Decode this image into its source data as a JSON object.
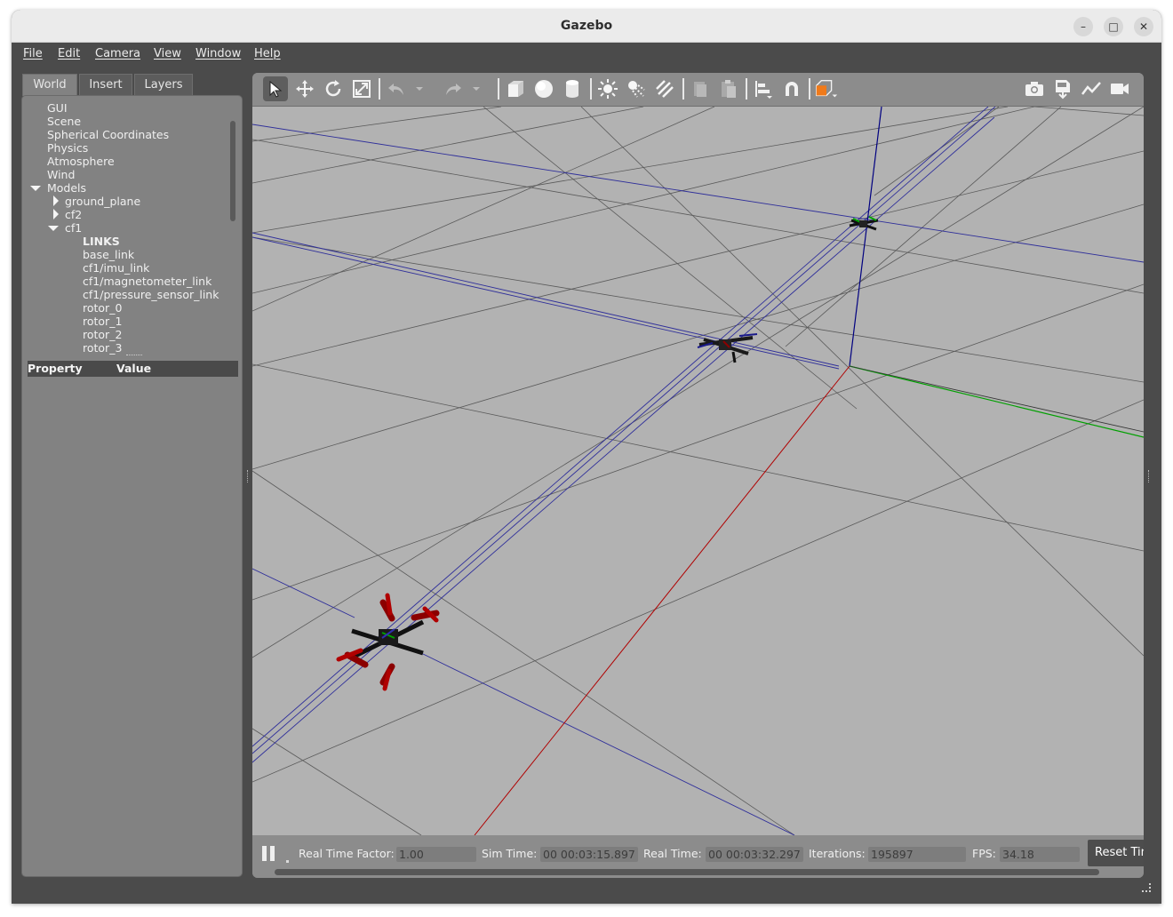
{
  "window": {
    "title": "Gazebo",
    "controls": {
      "minimize": "–",
      "maximize": "□",
      "close": "✕"
    }
  },
  "menubar": {
    "items": [
      "File",
      "Edit",
      "Camera",
      "View",
      "Window",
      "Help"
    ]
  },
  "left_panel": {
    "tabs": [
      "World",
      "Insert",
      "Layers"
    ],
    "active_tab": "World",
    "tree": {
      "gui": "GUI",
      "scene": "Scene",
      "spherical_coordinates": "Spherical Coordinates",
      "physics": "Physics",
      "atmosphere": "Atmosphere",
      "wind": "Wind",
      "models": "Models",
      "ground_plane": "ground_plane",
      "cf2": "cf2",
      "cf1": "cf1",
      "links_header": "LINKS",
      "links": [
        "base_link",
        "cf1/imu_link",
        "cf1/magnetometer_link",
        "cf1/pressure_sensor_link",
        "rotor_0",
        "rotor_1",
        "rotor_2",
        "rotor_3"
      ]
    },
    "property_table": {
      "property_header": "Property",
      "value_header": "Value"
    }
  },
  "toolbar": {
    "icons": [
      "select-mode-icon",
      "translate-mode-icon",
      "rotate-mode-icon",
      "scale-mode-icon",
      "undo-icon",
      "undo-history-icon",
      "redo-icon",
      "redo-history-icon",
      "box-icon",
      "sphere-icon",
      "cylinder-icon",
      "point-light-icon",
      "spot-light-icon",
      "directional-light-icon",
      "copy-icon",
      "paste-icon",
      "align-icon",
      "snap-icon",
      "change-view-icon",
      "screenshot-icon",
      "log-icon",
      "plot-icon",
      "video-record-icon"
    ],
    "accent_color": "#f07a1a"
  },
  "bottom_bar": {
    "real_time_factor_label": "Real Time Factor:",
    "real_time_factor": "1.00",
    "sim_time_label": "Sim Time:",
    "sim_time": "00 00:03:15.897",
    "real_time_label": "Real Time:",
    "real_time": "00 00:03:32.297",
    "iterations_label": "Iterations:",
    "iterations": "195897",
    "fps_label": "FPS:",
    "fps": "34.18",
    "reset_label": "Reset Time"
  },
  "scene": {
    "background": "#b2b2b2",
    "axis_colors": {
      "x": "#b00000",
      "y": "#00a000",
      "z": "#000080"
    },
    "drone_arm_color": "#8b0000",
    "drone_body_color": "#111111"
  }
}
